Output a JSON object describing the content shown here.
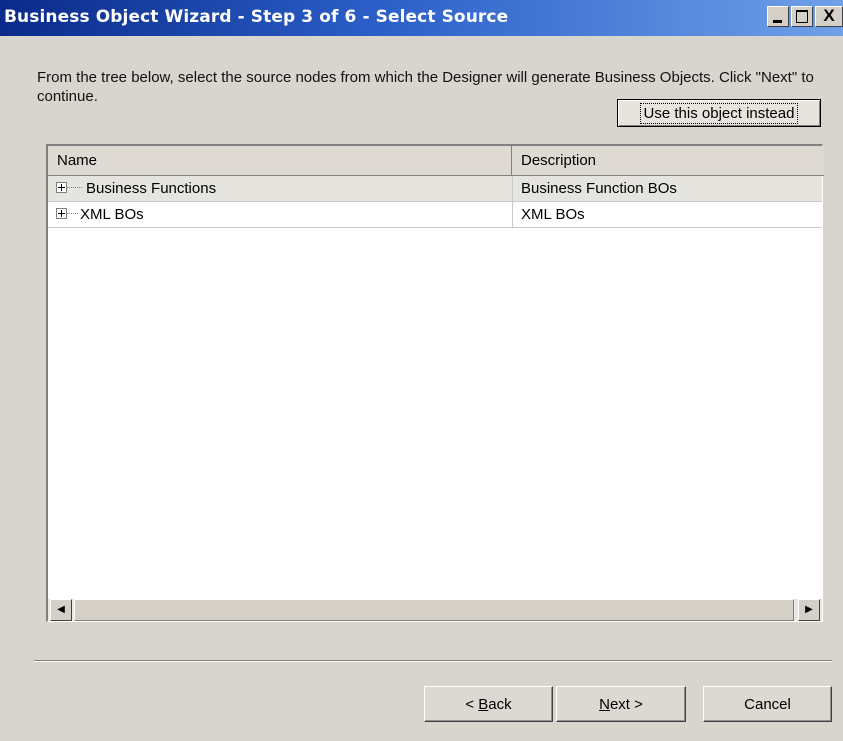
{
  "window": {
    "title": "Business Object Wizard - Step 3 of 6 - Select Source",
    "controls": {
      "minimize": "_",
      "maximize": "□",
      "close": "X"
    }
  },
  "instruction": "From the tree below, select the source nodes from which the Designer will generate Business Objects. Click \"Next\" to continue.",
  "use_object_button": "Use this object instead",
  "table": {
    "columns": [
      "Name",
      "Description"
    ],
    "rows": [
      {
        "name": "Business Functions",
        "description": "Business Function BOs"
      },
      {
        "name": "XML BOs",
        "description": "XML BOs"
      }
    ]
  },
  "scrollbar": {
    "left_arrow": "◀",
    "right_arrow": "▶"
  },
  "buttons": {
    "back_prefix": "< ",
    "back_key": "B",
    "back_rest": "ack",
    "next_key": "N",
    "next_rest": "ext >",
    "cancel": "Cancel"
  }
}
